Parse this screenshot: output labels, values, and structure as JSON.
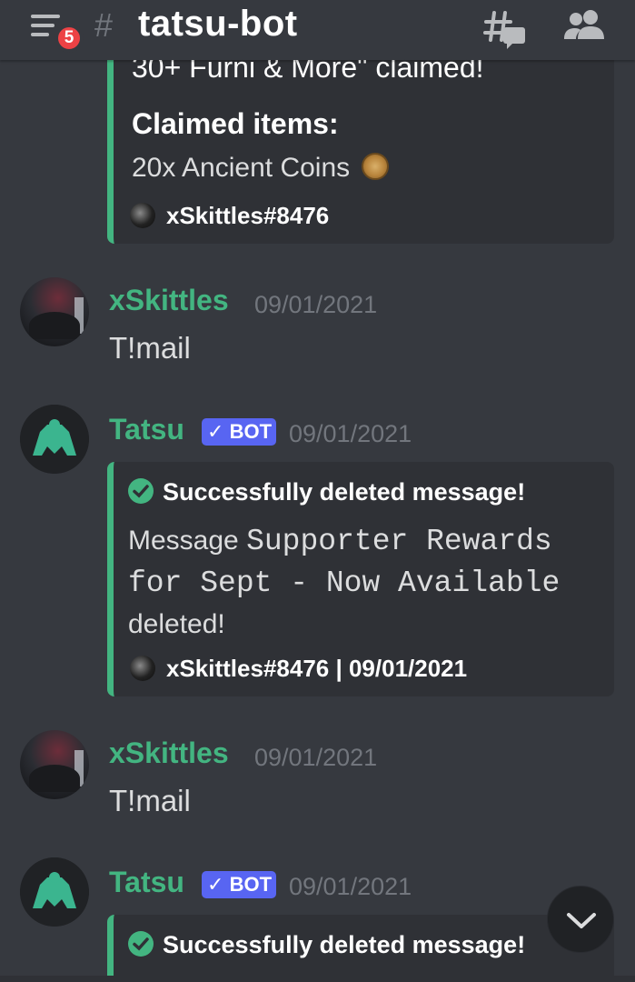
{
  "header": {
    "notification_count": "5",
    "hash": "#",
    "channel_name": "tatsu-bot"
  },
  "messages": [
    {
      "type": "embed_partial",
      "cut_title": "30+ Furni & More\" claimed!",
      "field_name": "Claimed items:",
      "field_value": "20x Ancient Coins",
      "footer": "xSkittles#8476"
    },
    {
      "type": "user",
      "username": "xSkittles",
      "timestamp": "09/01/2021",
      "content": "T!mail"
    },
    {
      "type": "bot",
      "username": "Tatsu",
      "bot_tag": "BOT",
      "timestamp": "09/01/2021",
      "embed_title": "Successfully deleted message!",
      "desc_prefix": "Message",
      "desc_code": "Supporter Rewards for Sept - Now Available",
      "desc_suffix": "deleted!",
      "footer": "xSkittles#8476 | 09/01/2021"
    },
    {
      "type": "user",
      "username": "xSkittles",
      "timestamp": "09/01/2021",
      "content": "T!mail"
    },
    {
      "type": "bot",
      "username": "Tatsu",
      "bot_tag": "BOT",
      "timestamp": "09/01/2021",
      "embed_title": "Successfully deleted message!"
    }
  ],
  "colors": {
    "background": "#36393f",
    "embed_background": "#2f3136",
    "embed_accent": "#43b581",
    "username": "#43b581",
    "bot_tag": "#5865f2",
    "badge": "#ed4245",
    "timestamp": "#72767d"
  },
  "icons": {
    "menu": "hamburger-menu-icon",
    "threads": "threads-icon",
    "members": "members-icon",
    "coin": "ancient-coin-icon",
    "check": "check-circle-icon",
    "scroll": "chevron-down-icon"
  }
}
